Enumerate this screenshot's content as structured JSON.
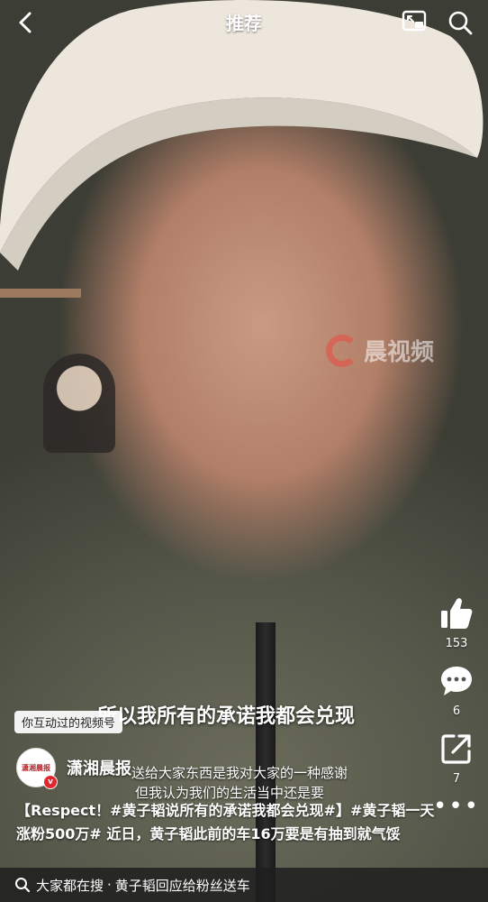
{
  "topbar": {
    "title": "推荐",
    "back_icon": "chevron-left-icon",
    "float_icon": "picture-in-picture-icon",
    "search_icon": "search-icon"
  },
  "watermark": {
    "text": "晨视频"
  },
  "actions": {
    "like_count": "153",
    "comment_count": "6",
    "share_count": "7"
  },
  "subtitles": {
    "main": "所以我所有的承诺我都会兑现",
    "line1": "送给大家东西是我对大家的一种感谢",
    "line2": "但我认为我们的生活当中还是要"
  },
  "hint": {
    "text": "你互动过的视频号"
  },
  "author": {
    "name": "潇湘晨报",
    "avatar_text": "潇湘晨报",
    "verified_mark": "v"
  },
  "caption": {
    "text": "【Respect！#黄子韬说所有的承诺我都会兑现#】#黄子韬一天涨粉500万# 近日，黄子韬此前的车16万要是有抽到就气馁"
  },
  "bottom": {
    "prefix": "大家都在搜",
    "separator": "·",
    "query": "黄子韬回应给粉丝送车"
  },
  "colors": {
    "accent_red": "#e0262f",
    "overlay_dark": "#1e1e1e"
  }
}
